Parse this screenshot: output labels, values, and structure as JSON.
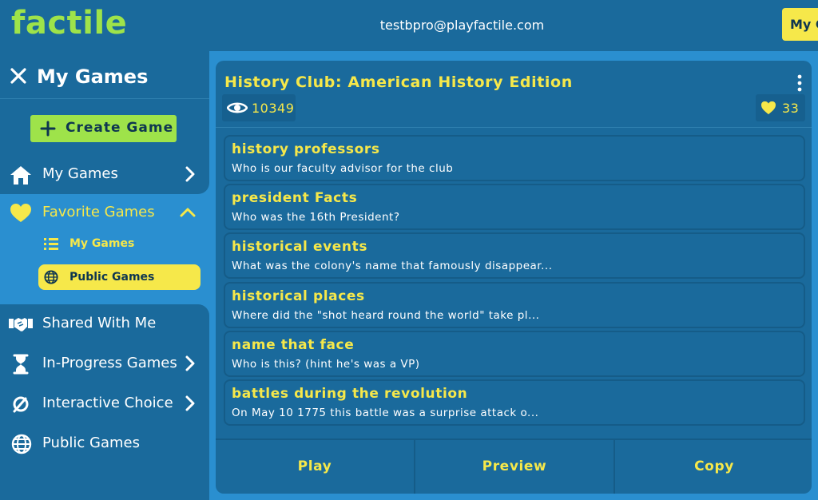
{
  "header": {
    "logo": "factile",
    "user_email": "testbpro@playfactile.com",
    "my_games_button": "My G"
  },
  "sidebar": {
    "title": "My Games",
    "create_button": "Create Game",
    "items": [
      {
        "label": "My Games",
        "icon": "home-icon",
        "chevron": "right"
      },
      {
        "label": "Favorite Games",
        "icon": "heart-icon",
        "chevron": "up"
      },
      {
        "label": "Shared With Me",
        "icon": "handshake-icon"
      },
      {
        "label": "In-Progress Games",
        "icon": "hourglass-icon",
        "chevron": "right"
      },
      {
        "label": "Interactive Choice",
        "icon": "interactive-icon",
        "chevron": "right"
      },
      {
        "label": "Public Games",
        "icon": "globe-icon"
      }
    ],
    "sub_items": [
      {
        "label": "My Games",
        "icon": "list-icon",
        "active": false
      },
      {
        "label": "Public Games",
        "icon": "globe-icon",
        "active": true
      }
    ]
  },
  "game": {
    "title": "History Club: American History Edition",
    "views": "10349",
    "likes": "33",
    "questions": [
      {
        "category": "history professors",
        "text": "Who is our faculty advisor for the club"
      },
      {
        "category": "president Facts",
        "text": "Who was the 16th President?"
      },
      {
        "category": "historical events",
        "text": "What was the colony's name that famously disappear..."
      },
      {
        "category": "historical places",
        "text": "Where did the \"shot heard round the world\" take pl..."
      },
      {
        "category": "name that face",
        "text": "Who is this? (hint he's was a VP)"
      },
      {
        "category": "battles during the revolution",
        "text": "On May 10 1775 this battle was a surprise attack o..."
      }
    ],
    "actions": {
      "play": "Play",
      "preview": "Preview",
      "copy": "Copy"
    }
  },
  "colors": {
    "background": "#1a6a9c",
    "panel": "#2a8fd0",
    "accent_yellow": "#f6e84a",
    "accent_green": "#9ee34a"
  }
}
